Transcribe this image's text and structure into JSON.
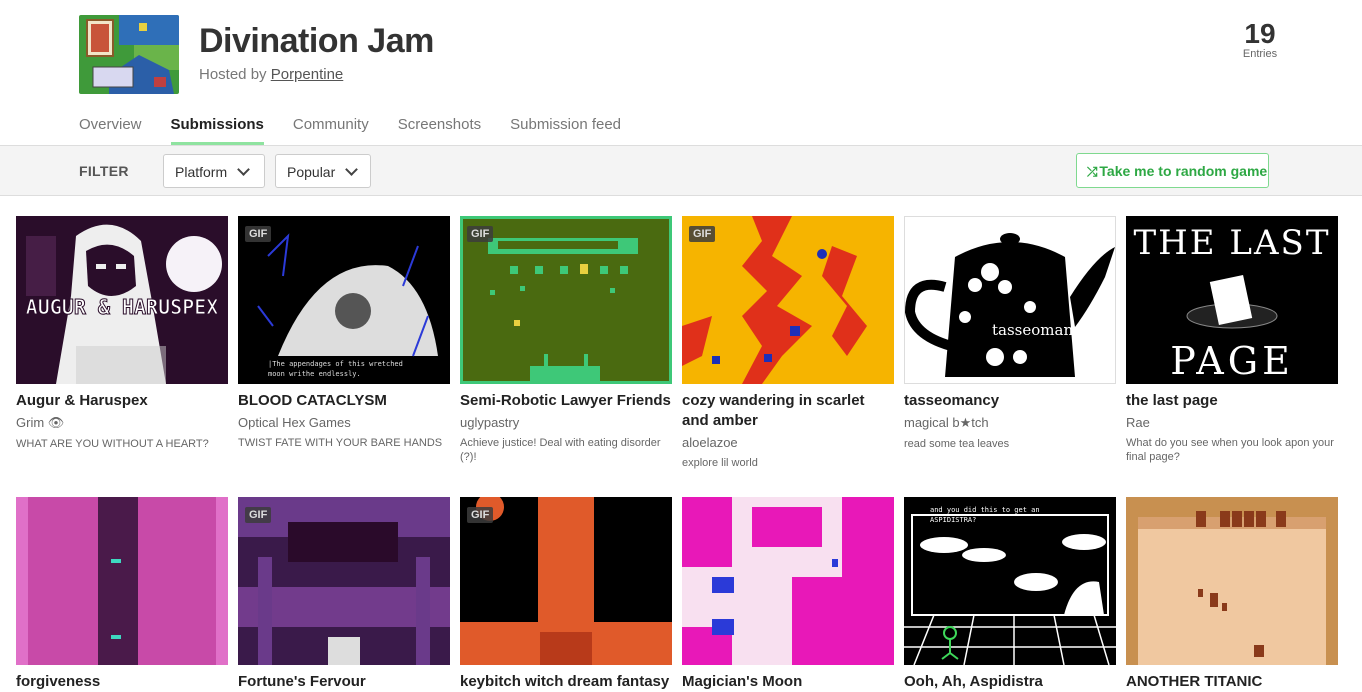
{
  "header": {
    "title": "Divination Jam",
    "hosted_prefix": "Hosted by",
    "host": "Porpentine",
    "entries_count": "19",
    "entries_label": "Entries"
  },
  "tabs": [
    {
      "label": "Overview",
      "active": false
    },
    {
      "label": "Submissions",
      "active": true
    },
    {
      "label": "Community",
      "active": false
    },
    {
      "label": "Screenshots",
      "active": false
    },
    {
      "label": "Submission feed",
      "active": false
    }
  ],
  "filter": {
    "label": "FILTER",
    "platform": "Platform",
    "sort": "Popular",
    "random_label": "Take me to random game"
  },
  "colors": {
    "accent_green": "#2ea844",
    "tab_underline": "#8fe3a0"
  },
  "games": [
    {
      "title": "Augur & Haruspex",
      "author": "Grim 👁",
      "desc": "WHAT ARE YOU WITHOUT A HEART?",
      "gif": false,
      "thumb_text": "AUGUR & HARUSPEX"
    },
    {
      "title": "BLOOD CATACLYSM",
      "author": "Optical Hex Games",
      "desc": "TWIST FATE WITH YOUR BARE HANDS",
      "gif": true,
      "gif_label": "GIF",
      "thumb_text": "|The appendages of this wretched moon writhe endlessly."
    },
    {
      "title": "Semi-Robotic Lawyer Friends",
      "author": "uglypastry",
      "desc": "Achieve justice! Deal with eating disorder (?)!",
      "gif": true,
      "gif_label": "GIF"
    },
    {
      "title": "cozy wandering in scarlet and amber",
      "author": "aloelazoe",
      "desc": "explore lil world",
      "gif": true,
      "gif_label": "GIF"
    },
    {
      "title": "tasseomancy",
      "author": "magical b★tch",
      "desc": "read some tea leaves",
      "gif": false,
      "thumb_text": "tasseomancy"
    },
    {
      "title": "the last page",
      "author": "Rae",
      "desc": "What do you see when you look apon your final page?",
      "gif": false,
      "thumb_text_top": "THE LAST",
      "thumb_text_bottom": "PAGE"
    },
    {
      "title": "forgiveness",
      "author": "",
      "desc": "",
      "gif": false
    },
    {
      "title": "Fortune's Fervour",
      "author": "",
      "desc": "",
      "gif": true,
      "gif_label": "GIF"
    },
    {
      "title": "keybitch witch dream fantasy",
      "author": "",
      "desc": "",
      "gif": true,
      "gif_label": "GIF"
    },
    {
      "title": "Magician's Moon",
      "author": "",
      "desc": "",
      "gif": false
    },
    {
      "title": "Ooh, Ah, Aspidistra",
      "author": "",
      "desc": "",
      "gif": false,
      "thumb_text": "and you did this to get an ASPIDISTRA?"
    },
    {
      "title": "ANOTHER TITANIC",
      "author": "",
      "desc": "",
      "gif": false
    }
  ]
}
